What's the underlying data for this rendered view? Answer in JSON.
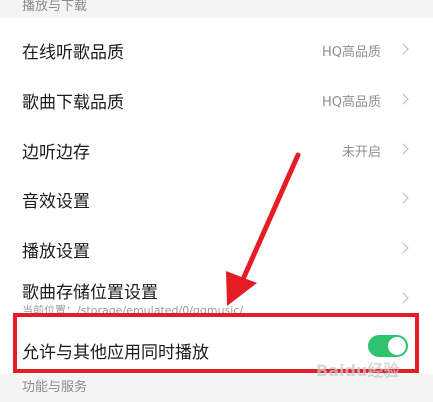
{
  "sections": {
    "playback_download": "播放与下载",
    "features_services": "功能与服务"
  },
  "rows": {
    "online_quality": {
      "label": "在线听歌品质",
      "value": "HQ高品质"
    },
    "download_quality": {
      "label": "歌曲下载品质",
      "value": "HQ高品质"
    },
    "cache_while_play": {
      "label": "边听边存",
      "value": "未开启"
    },
    "sound_effects": {
      "label": "音效设置"
    },
    "playback_settings": {
      "label": "播放设置"
    },
    "storage_location": {
      "label": "歌曲存储位置设置",
      "sub": "当前位置：/storage/emulated/0/qqmusic/"
    },
    "allow_mix_playback": {
      "label": "允许与其他应用同时播放",
      "enabled": true
    }
  },
  "watermark": "Baidu经验",
  "colors": {
    "toggle_on": "#2fc271",
    "annotation_red": "#e51e25"
  }
}
